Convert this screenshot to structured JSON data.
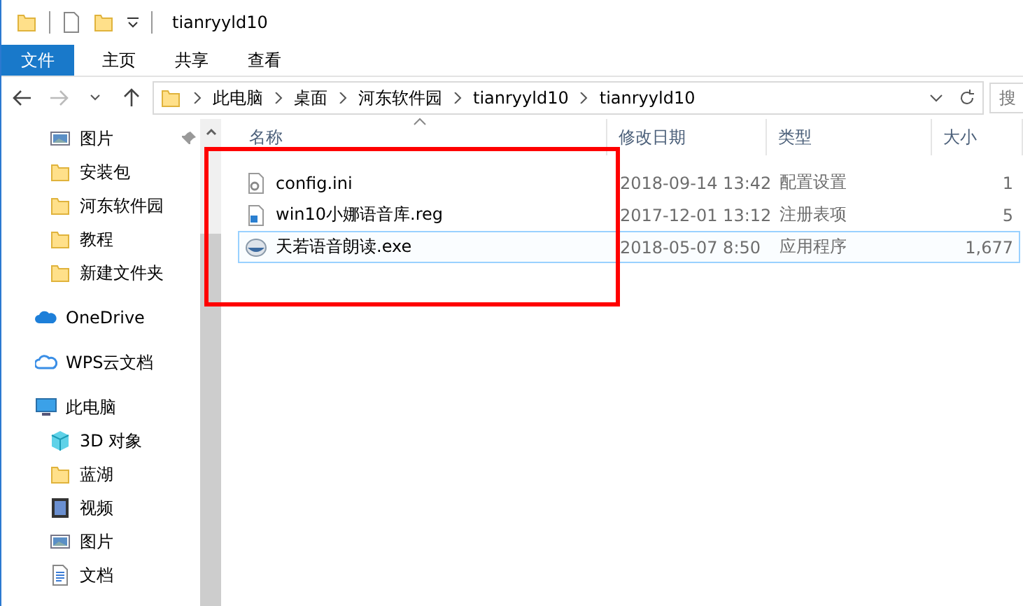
{
  "window": {
    "title": "tianryyld10"
  },
  "ribbon_tabs": [
    {
      "label": "文件",
      "kind": "file",
      "selected": false
    },
    {
      "label": "主页",
      "kind": "tab",
      "selected": false
    },
    {
      "label": "共享",
      "kind": "tab",
      "selected": false
    },
    {
      "label": "查看",
      "kind": "tab",
      "selected": false
    }
  ],
  "address_bar": {
    "segments": [
      "此电脑",
      "桌面",
      "河东软件园",
      "tianryyld10",
      "tianryyld10"
    ]
  },
  "search": {
    "placeholder": "搜"
  },
  "sidebar": {
    "items": [
      {
        "label": "图片",
        "kind": "picture",
        "pinned": true
      },
      {
        "label": "安装包",
        "kind": "folder",
        "pinned": false
      },
      {
        "label": "河东软件园",
        "kind": "folder",
        "pinned": false
      },
      {
        "label": "教程",
        "kind": "folder",
        "pinned": false
      },
      {
        "label": "新建文件夹",
        "kind": "folder",
        "pinned": false
      },
      {
        "label": "OneDrive",
        "kind": "cloud",
        "pinned": false
      },
      {
        "label": "WPS云文档",
        "kind": "outline",
        "pinned": false
      },
      {
        "label": "此电脑",
        "kind": "computer",
        "pinned": false,
        "children": [
          {
            "label": "3D 对象",
            "kind": "cube",
            "pinned": false
          },
          {
            "label": "蓝湖",
            "kind": "folder",
            "pinned": false
          },
          {
            "label": "视频",
            "kind": "film",
            "pinned": false
          },
          {
            "label": "图片",
            "kind": "picture",
            "pinned": false
          },
          {
            "label": "文档",
            "kind": "document",
            "pinned": false
          }
        ]
      }
    ]
  },
  "table": {
    "columns": [
      "名称",
      "修改日期",
      "类型",
      "大小"
    ],
    "rows": [
      {
        "kind": "settings",
        "name": "config.ini",
        "date": "2018-09-14 13:42",
        "type": "配置设置",
        "size": "1",
        "selected": false
      },
      {
        "kind": "registry",
        "name": "win10小娜语音库.reg",
        "date": "2017-12-01 13:12",
        "type": "注册表项",
        "size": "5",
        "selected": false
      },
      {
        "kind": "app",
        "name": "天若语音朗读.exe",
        "date": "2018-05-07 8:50",
        "type": "应用程序",
        "size": "1,677",
        "selected": true
      }
    ]
  },
  "annotation_frame": {
    "shown": true
  }
}
